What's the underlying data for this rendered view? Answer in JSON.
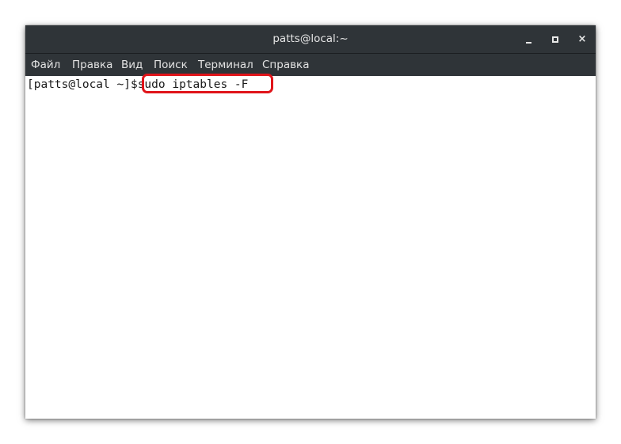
{
  "window": {
    "title": "patts@local:~"
  },
  "window_controls": {
    "minimize": "minimize",
    "maximize": "maximize",
    "close": "×"
  },
  "menu": {
    "items": [
      {
        "label": "Файл"
      },
      {
        "label": "Правка"
      },
      {
        "label": "Вид"
      },
      {
        "label": "Поиск"
      },
      {
        "label": "Терминал"
      },
      {
        "label": "Справка"
      }
    ]
  },
  "terminal": {
    "prompt": "[patts@local ~]$",
    "command": "sudo iptables -F",
    "highlight_color": "#e0141a"
  },
  "colors": {
    "titlebar": "#2f3438",
    "terminal_bg": "#ffffff",
    "text": "#1a1a1a"
  }
}
